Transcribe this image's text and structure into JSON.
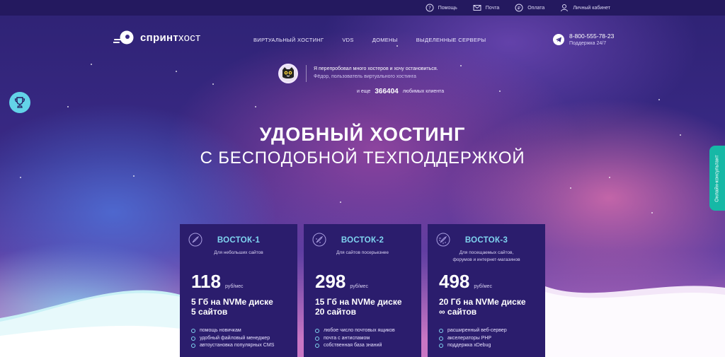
{
  "topbar": {
    "help": "Помощь",
    "mail": "Почта",
    "payment": "Оплата",
    "account": "Личный кабинет"
  },
  "brand": {
    "name_bold": "спринт",
    "name_light": "хост"
  },
  "nav": [
    "ВИРТУАЛЬНЫЙ ХОСТИНГ",
    "VDS",
    "ДОМЕНЫ",
    "ВЫДЕЛЕННЫЕ СЕРВЕРЫ"
  ],
  "contact": {
    "phone": "8-800-555-78-23",
    "support": "Поддержка 24/7"
  },
  "testimonial": {
    "quote": "Я перепробовал много хостеров и хочу остановиться.",
    "author": "Фёдор, пользователь виртуального хостинга",
    "prefix": "и еще",
    "count": "366404",
    "suffix": "любимых клиента"
  },
  "hero": {
    "line1": "УДОБНЫЙ ХОСТИНГ",
    "line2": "С БЕСПОДОБНОЙ ТЕХПОДДЕРЖКОЙ"
  },
  "side_tab": "Онлайн-консультант",
  "plans": [
    {
      "title": "ВОСТОК-1",
      "subtitle_1": "Для небольших сайтов",
      "subtitle_2": "",
      "price": "118",
      "unit": "руб/мес",
      "disk": "5 Гб на NVMe диске",
      "sites": "5 сайтов",
      "features": [
        "помощь новичкам",
        "удобный файловый менеджер",
        "автоустановка популярных CMS"
      ]
    },
    {
      "title": "ВОСТОК-2",
      "subtitle_1": "Для сайтов посерьезнее",
      "subtitle_2": "",
      "price": "298",
      "unit": "руб/мес",
      "disk": "15 Гб на NVMe диске",
      "sites": "20 сайтов",
      "features": [
        "любое число почтовых ящиков",
        "почта с антиспамом",
        "собственная база знаний"
      ]
    },
    {
      "title": "ВОСТОК-3",
      "subtitle_1": "Для посещаемых сайтов,",
      "subtitle_2": "форумов и интернет-магазинов",
      "price": "498",
      "unit": "руб/мес",
      "disk": "20 Гб на NVMe диске",
      "sites": "∞ сайтов",
      "features": [
        "расширенный веб-сервер",
        "акселераторы PHP",
        "поддержка xDebug"
      ]
    }
  ],
  "colors": {
    "accent": "#7fd4ef",
    "card_bg": "#2b1d6d",
    "topbar_bg": "#24195f",
    "side_tab": "#16b8a6"
  }
}
